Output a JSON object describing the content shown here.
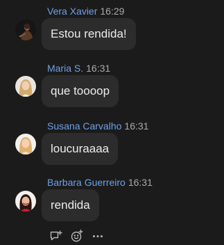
{
  "messages": [
    {
      "sender": "Vera Xavier",
      "time": "16:29",
      "text": "Estou rendida!"
    },
    {
      "sender": "Maria S.",
      "time": "16:31",
      "text": "que toooop"
    },
    {
      "sender": "Susana Carvalho",
      "time": "16:31",
      "text": "loucuraaaa"
    },
    {
      "sender": "Barbara Guerreiro",
      "time": "16:31",
      "text": "rendida"
    }
  ],
  "actions": {
    "icons": [
      "reply-in-thread-icon",
      "add-reaction-icon",
      "more-options-icon"
    ]
  },
  "colors": {
    "background": "#1b1b1b",
    "bubble": "#2c2c2c",
    "sender_name": "#6fa0e8",
    "timestamp": "#a9a9a9"
  }
}
